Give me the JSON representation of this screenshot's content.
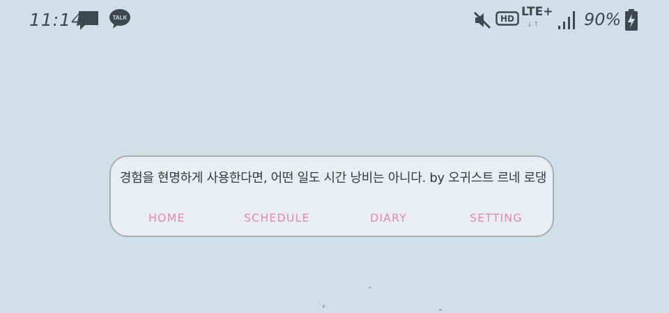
{
  "status_bar": {
    "time": "11:14",
    "network": "LTE+",
    "network_arrows": "↓↑",
    "hd_label": "HD",
    "battery": "90%",
    "icons": [
      "message-icon",
      "kakaotalk-icon",
      "mute-icon",
      "hd-voice-icon",
      "lte-icon",
      "signal-icon",
      "battery-charging-icon"
    ]
  },
  "notifications": {
    "talk_label": "TALK"
  },
  "widget": {
    "quote": "경험을 현명하게 사용한다면, 어떤 일도 시간 낭비는 아니다. by 오귀스트 르네 로댕",
    "nav": [
      {
        "label": "HOME"
      },
      {
        "label": "SCHEDULE"
      },
      {
        "label": "DIARY"
      },
      {
        "label": "SETTING"
      }
    ]
  },
  "colors": {
    "background": "#cfe0e8",
    "widget_bg": "#e8eef2",
    "widget_border": "#a9adb2",
    "nav_accent": "#e58aa8",
    "icon": "#3d4850"
  }
}
